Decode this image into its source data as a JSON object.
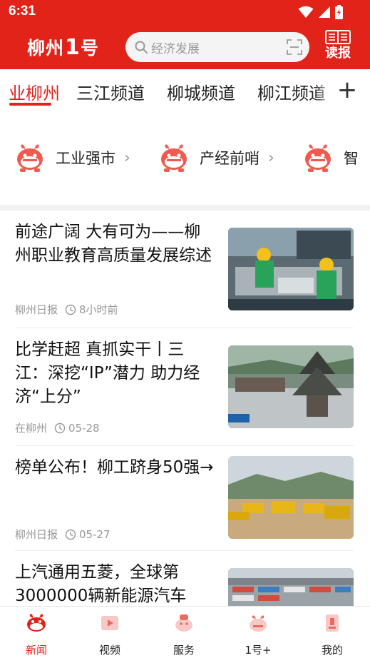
{
  "status": {
    "time": "6:31"
  },
  "header": {
    "logo_part1": "柳州",
    "logo_mark": "1",
    "logo_part2": "号",
    "search_placeholder": "经济发展",
    "read_label": "读报",
    "brand_color": "#e2231a"
  },
  "tabs": [
    {
      "label": "业柳州",
      "active": true
    },
    {
      "label": "三江频道",
      "active": false
    },
    {
      "label": "柳城频道",
      "active": false
    },
    {
      "label": "柳江频道",
      "active": false
    }
  ],
  "tab_plus": "+",
  "topics": [
    {
      "label": "工业强市",
      "chevron": "›",
      "icon": "mascot-icon"
    },
    {
      "label": "产经前哨",
      "chevron": "›",
      "icon": "mascot-icon"
    },
    {
      "label": "智",
      "chevron": "",
      "icon": "mascot-icon"
    }
  ],
  "news": [
    {
      "title": "前途广阔  大有可为——柳州职业教育高质量发展综述",
      "source": "柳州日报",
      "time": "8小时前",
      "thumb": "workers-training-photo"
    },
    {
      "title": "比学赶超  真抓实干丨三江：深挖“IP”潜力  助力经济“上分”",
      "source": "在柳州",
      "time": "05-28",
      "thumb": "drum-tower-crowd-photo"
    },
    {
      "title": "榜单公布！柳工跻身50强→",
      "source": "柳州日报",
      "time": "05-27",
      "thumb": "construction-trucks-photo"
    },
    {
      "title": "上汽通用五菱，全球第3000000辆新能源汽车",
      "source": "",
      "time": "",
      "thumb": "port-vehicles-photo"
    }
  ],
  "bottom_nav": [
    {
      "label": "新闻",
      "active": true,
      "icon": "news-icon"
    },
    {
      "label": "视频",
      "active": false,
      "icon": "video-icon"
    },
    {
      "label": "服务",
      "active": false,
      "icon": "service-icon"
    },
    {
      "label": "1号+",
      "active": false,
      "icon": "plus-icon"
    },
    {
      "label": "我的",
      "active": false,
      "icon": "profile-icon"
    }
  ]
}
